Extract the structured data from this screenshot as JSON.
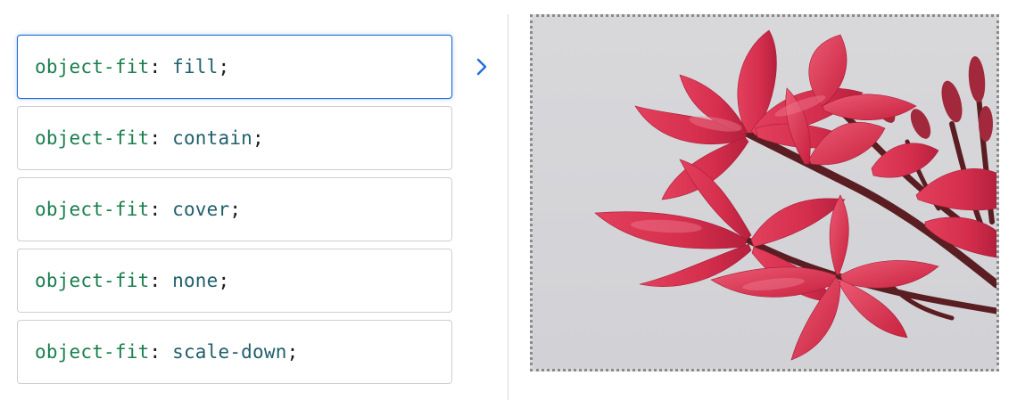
{
  "options": [
    {
      "property": "object-fit",
      "value": "fill",
      "selected": true
    },
    {
      "property": "object-fit",
      "value": "contain",
      "selected": false
    },
    {
      "property": "object-fit",
      "value": "cover",
      "selected": false
    },
    {
      "property": "object-fit",
      "value": "none",
      "selected": false
    },
    {
      "property": "object-fit",
      "value": "scale-down",
      "selected": false
    }
  ],
  "punctuation": {
    "colon": ":",
    "semicolon": ";"
  },
  "icons": {
    "selection_indicator": "chevron-right-icon",
    "preview_image": "frangipani-flowers-image"
  },
  "colors": {
    "selected_border": "#1f6fd6",
    "property_text": "#1a7f4e",
    "value_text": "#1f5f6b",
    "chevron": "#1f6fd6",
    "preview_background": "#dcdcdf",
    "petal": "#d8304f"
  }
}
